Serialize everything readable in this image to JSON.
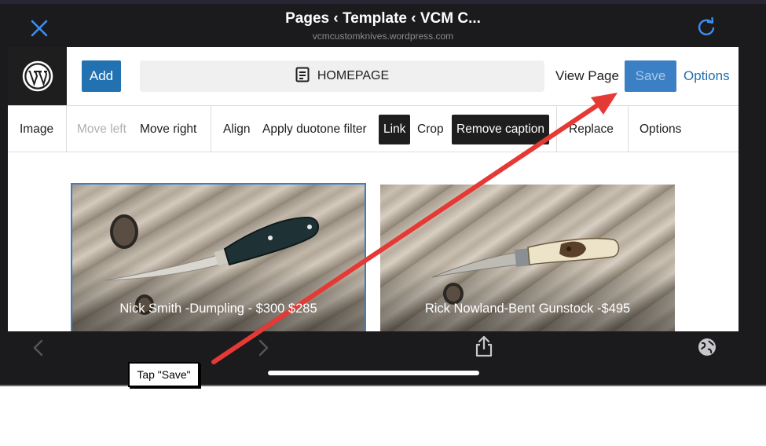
{
  "browser": {
    "title": "Pages ‹ Template ‹ VCM C...",
    "url": "vcmcustomknives.wordpress.com",
    "close_icon": "close-icon",
    "reload_icon": "reload-icon"
  },
  "editor_header": {
    "add_label": "Add",
    "document_label": "HOMEPAGE",
    "view_page_label": "View Page",
    "save_label": "Save",
    "options_label": "Options"
  },
  "block_toolbar": {
    "image": "Image",
    "move_left": "Move left",
    "move_right": "Move right",
    "align": "Align",
    "duotone": "Apply duotone filter",
    "link": "Link",
    "crop": "Crop",
    "remove_caption": "Remove caption",
    "replace": "Replace",
    "options": "Options"
  },
  "gallery": {
    "images": [
      {
        "caption": "Nick Smith -Dumpling - $300 $285"
      },
      {
        "caption": "Rick Nowland-Bent Gunstock -$495"
      }
    ]
  },
  "annotation": {
    "callout_text": "Tap \"Save\"",
    "arrow_color": "#e53935"
  },
  "colors": {
    "accent": "#2271b1",
    "toolbar_dark": "#1b1b1d"
  }
}
